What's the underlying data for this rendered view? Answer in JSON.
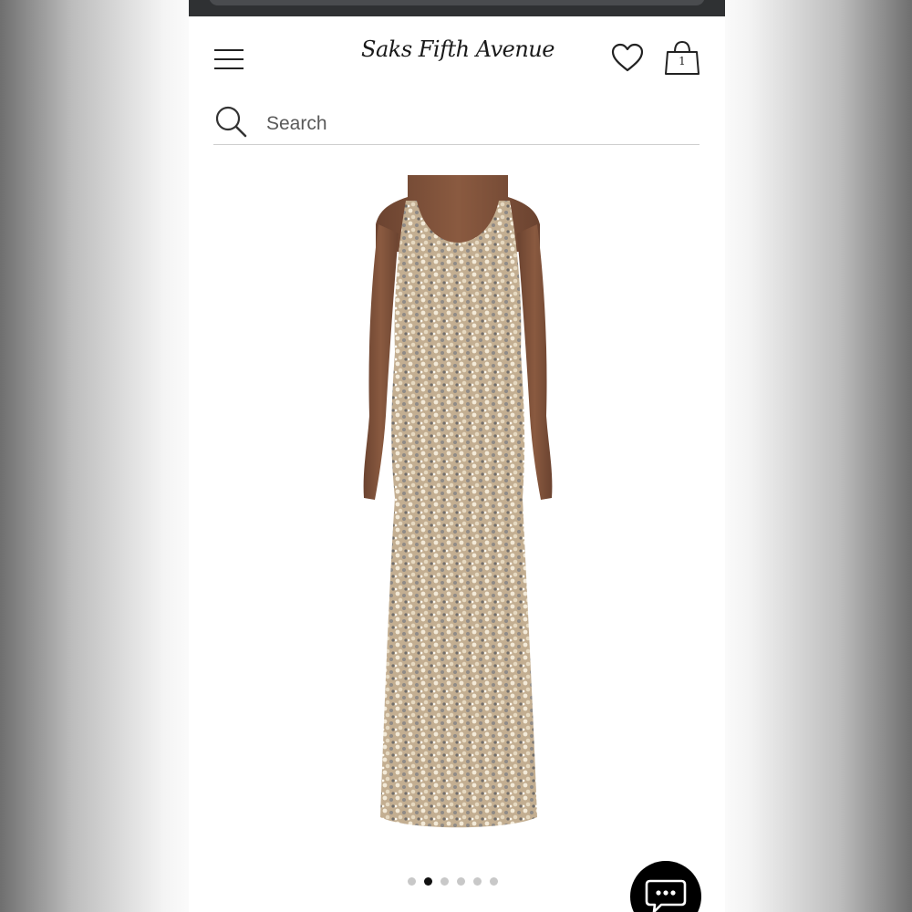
{
  "header": {
    "logo_text": "Saks Fifth Avenue",
    "bag_count": "1",
    "menu_icon": "hamburger-icon",
    "wishlist_icon": "heart-icon",
    "bag_icon": "shopping-bag-icon"
  },
  "search": {
    "placeholder": "Search",
    "icon": "search-icon"
  },
  "product": {
    "image_subject": "sequin-gown"
  },
  "carousel": {
    "total_slides": 6,
    "active_index": 1
  },
  "chat": {
    "icon": "chat-bubble-icon"
  }
}
